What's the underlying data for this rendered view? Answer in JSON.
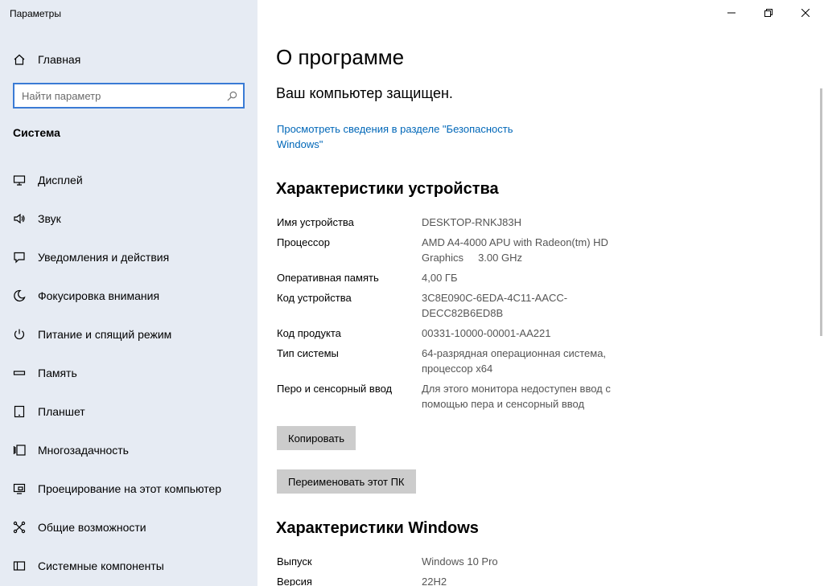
{
  "app": {
    "title": "Параметры"
  },
  "sidebar": {
    "home_label": "Главная",
    "search_placeholder": "Найти параметр",
    "section_title": "Система",
    "items": [
      {
        "label": "Дисплей",
        "icon": "display-icon"
      },
      {
        "label": "Звук",
        "icon": "sound-icon"
      },
      {
        "label": "Уведомления и действия",
        "icon": "notifications-icon"
      },
      {
        "label": "Фокусировка внимания",
        "icon": "focus-assist-icon"
      },
      {
        "label": "Питание и спящий режим",
        "icon": "power-icon"
      },
      {
        "label": "Память",
        "icon": "storage-icon"
      },
      {
        "label": "Планшет",
        "icon": "tablet-icon"
      },
      {
        "label": "Многозадачность",
        "icon": "multitasking-icon"
      },
      {
        "label": "Проецирование на этот компьютер",
        "icon": "projecting-icon"
      },
      {
        "label": "Общие возможности",
        "icon": "shared-experiences-icon"
      },
      {
        "label": "Системные компоненты",
        "icon": "system-components-icon"
      }
    ]
  },
  "main": {
    "page_title": "О программе",
    "protected_text": "Ваш компьютер защищен.",
    "security_link": "Просмотреть сведения в разделе \"Безопасность Windows\"",
    "device_specs_title": "Характеристики устройства",
    "device_specs": [
      {
        "key": "Имя устройства",
        "value": "DESKTOP-RNKJ83H"
      },
      {
        "key": "Процессор",
        "value": "AMD A4-4000 APU with Radeon(tm) HD Graphics     3.00 GHz"
      },
      {
        "key": "Оперативная память",
        "value": "4,00 ГБ"
      },
      {
        "key": "Код устройства",
        "value": "3C8E090C-6EDA-4C11-AACC-DECC82B6ED8B"
      },
      {
        "key": "Код продукта",
        "value": "00331-10000-00001-AA221"
      },
      {
        "key": "Тип системы",
        "value": "64-разрядная операционная система, процессор x64"
      },
      {
        "key": "Перо и сенсорный ввод",
        "value": "Для этого монитора недоступен ввод с помощью пера и сенсорный ввод"
      }
    ],
    "copy_button": "Копировать",
    "rename_button": "Переименовать этот ПК",
    "windows_specs_title": "Характеристики Windows",
    "windows_specs": [
      {
        "key": "Выпуск",
        "value": "Windows 10 Pro"
      },
      {
        "key": "Версия",
        "value": "22H2"
      }
    ]
  },
  "colors": {
    "sidebar_bg": "#e6ebf3",
    "accent": "#0067b8",
    "search_border": "#3a7bd5",
    "button_bg": "#cccccc"
  }
}
